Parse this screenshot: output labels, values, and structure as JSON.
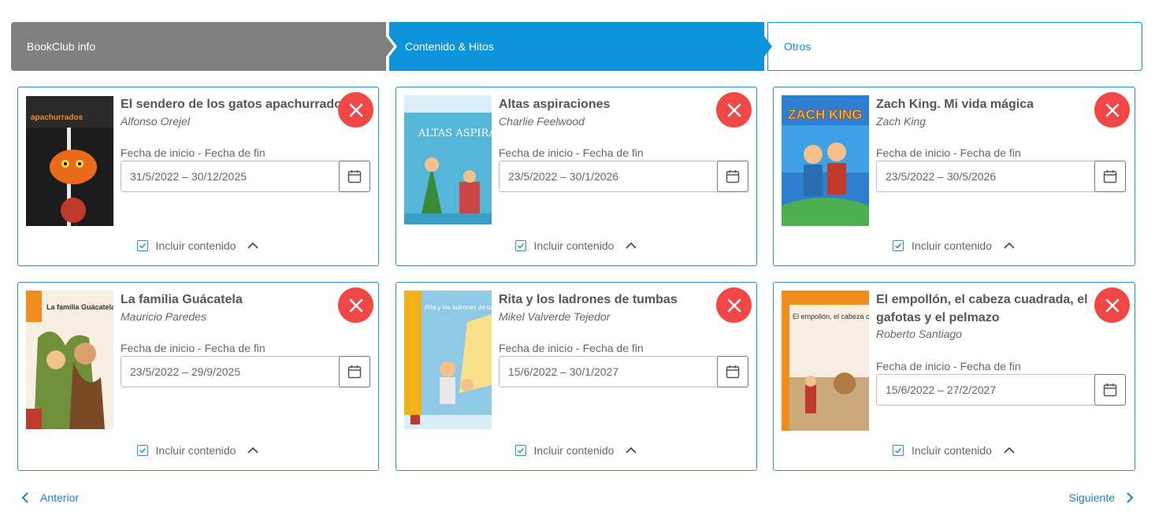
{
  "stepper": {
    "steps": [
      {
        "label": "BookClub info"
      },
      {
        "label": "Contenido & Hitos"
      },
      {
        "label": "Otros"
      }
    ]
  },
  "books": [
    {
      "title": "El sendero de los gatos apachurrados",
      "author": "Alfonso Orejel",
      "date_label": "Fecha de inicio - Fecha de fin",
      "date_range": "31/5/2022 – 30/12/2025",
      "include_label": "Incluir contenido",
      "cover_text": "apachurrados"
    },
    {
      "title": "Altas aspiraciones",
      "author": "Charlie Feelwood",
      "date_label": "Fecha de inicio - Fecha de fin",
      "date_range": "23/5/2022 – 30/1/2026",
      "include_label": "Incluir contenido",
      "cover_text": "ALTAS ASPIRACIONES"
    },
    {
      "title": "Zach King. Mi vida mágica",
      "author": "Zach King",
      "date_label": "Fecha de inicio - Fecha de fin",
      "date_range": "23/5/2022 – 30/5/2026",
      "include_label": "Incluir contenido",
      "cover_text": "ZACH KING"
    },
    {
      "title": "La familia Guácatela",
      "author": "Mauricio Paredes",
      "date_label": "Fecha de inicio - Fecha de fin",
      "date_range": "23/5/2022 – 29/9/2025",
      "include_label": "Incluir contenido",
      "cover_text": "La familia Guácatela"
    },
    {
      "title": "Rita y los ladrones de tumbas",
      "author": "Mikel Valverde Tejedor",
      "date_label": "Fecha de inicio - Fecha de fin",
      "date_range": "15/6/2022 – 30/1/2027",
      "include_label": "Incluir contenido",
      "cover_text": "Rita y los ladrones de tumbas"
    },
    {
      "title": "El empollón, el cabeza cuadrada, el gafotas y el pelmazo",
      "author": "Roberto Santiago",
      "date_label": "Fecha de inicio - Fecha de fin",
      "date_range": "15/6/2022 – 27/2/2027",
      "include_label": "Incluir contenido",
      "cover_text": "El empollón, el cabeza cuadrada, el gafotas y el pelmazo"
    }
  ],
  "nav": {
    "prev": "Anterior",
    "next": "Siguiente"
  },
  "colors": {
    "accent": "#0d93d9",
    "inactive_step": "#808080",
    "remove": "#f14747"
  }
}
